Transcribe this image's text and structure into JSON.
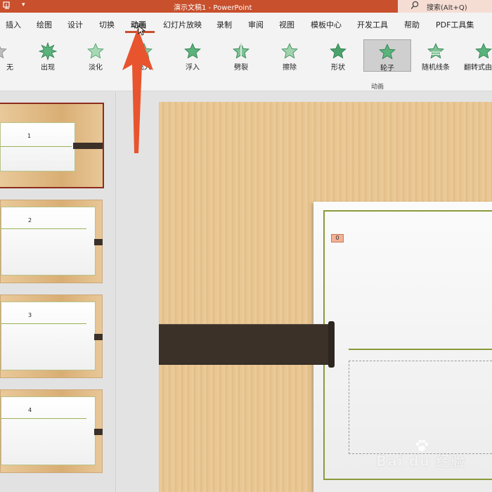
{
  "titlebar": {
    "dropdown": "▾",
    "title": "演示文稿1  -  PowerPoint",
    "search_placeholder": "搜索(Alt+Q)"
  },
  "tabs": [
    {
      "label": "插入"
    },
    {
      "label": "绘图"
    },
    {
      "label": "设计"
    },
    {
      "label": "切换"
    },
    {
      "label": "动画",
      "active": true
    },
    {
      "label": "幻灯片放映"
    },
    {
      "label": "录制"
    },
    {
      "label": "审阅"
    },
    {
      "label": "视图"
    },
    {
      "label": "模板中心"
    },
    {
      "label": "开发工具"
    },
    {
      "label": "帮助"
    },
    {
      "label": "PDF工具集"
    }
  ],
  "ribbon": {
    "animations": [
      {
        "label": "无",
        "icon": "star-gray-icon"
      },
      {
        "label": "出现",
        "icon": "star-burst-icon"
      },
      {
        "label": "淡化",
        "icon": "star-fade-icon"
      },
      {
        "label": "飞入",
        "icon": "star-fly-icon"
      },
      {
        "label": "浮入",
        "icon": "star-float-icon"
      },
      {
        "label": "劈裂",
        "icon": "star-split-icon"
      },
      {
        "label": "擦除",
        "icon": "star-wipe-icon"
      },
      {
        "label": "形状",
        "icon": "star-shape-icon"
      },
      {
        "label": "轮子",
        "icon": "star-wheel-icon",
        "selected": true
      },
      {
        "label": "随机线条",
        "icon": "star-lines-icon"
      },
      {
        "label": "翻转式由远及近",
        "icon": "star-flip-icon"
      }
    ],
    "group_label": "动画"
  },
  "thumbnails": [
    {
      "number": "1",
      "selected": true
    },
    {
      "number": "2"
    },
    {
      "number": "3"
    },
    {
      "number": "4"
    }
  ],
  "slide": {
    "animation_tag": "0"
  },
  "watermark": {
    "text": "Bai du 经验"
  },
  "colors": {
    "accent": "#c8502d",
    "star_green": "#4aa36b",
    "strap": "#3b3129"
  }
}
